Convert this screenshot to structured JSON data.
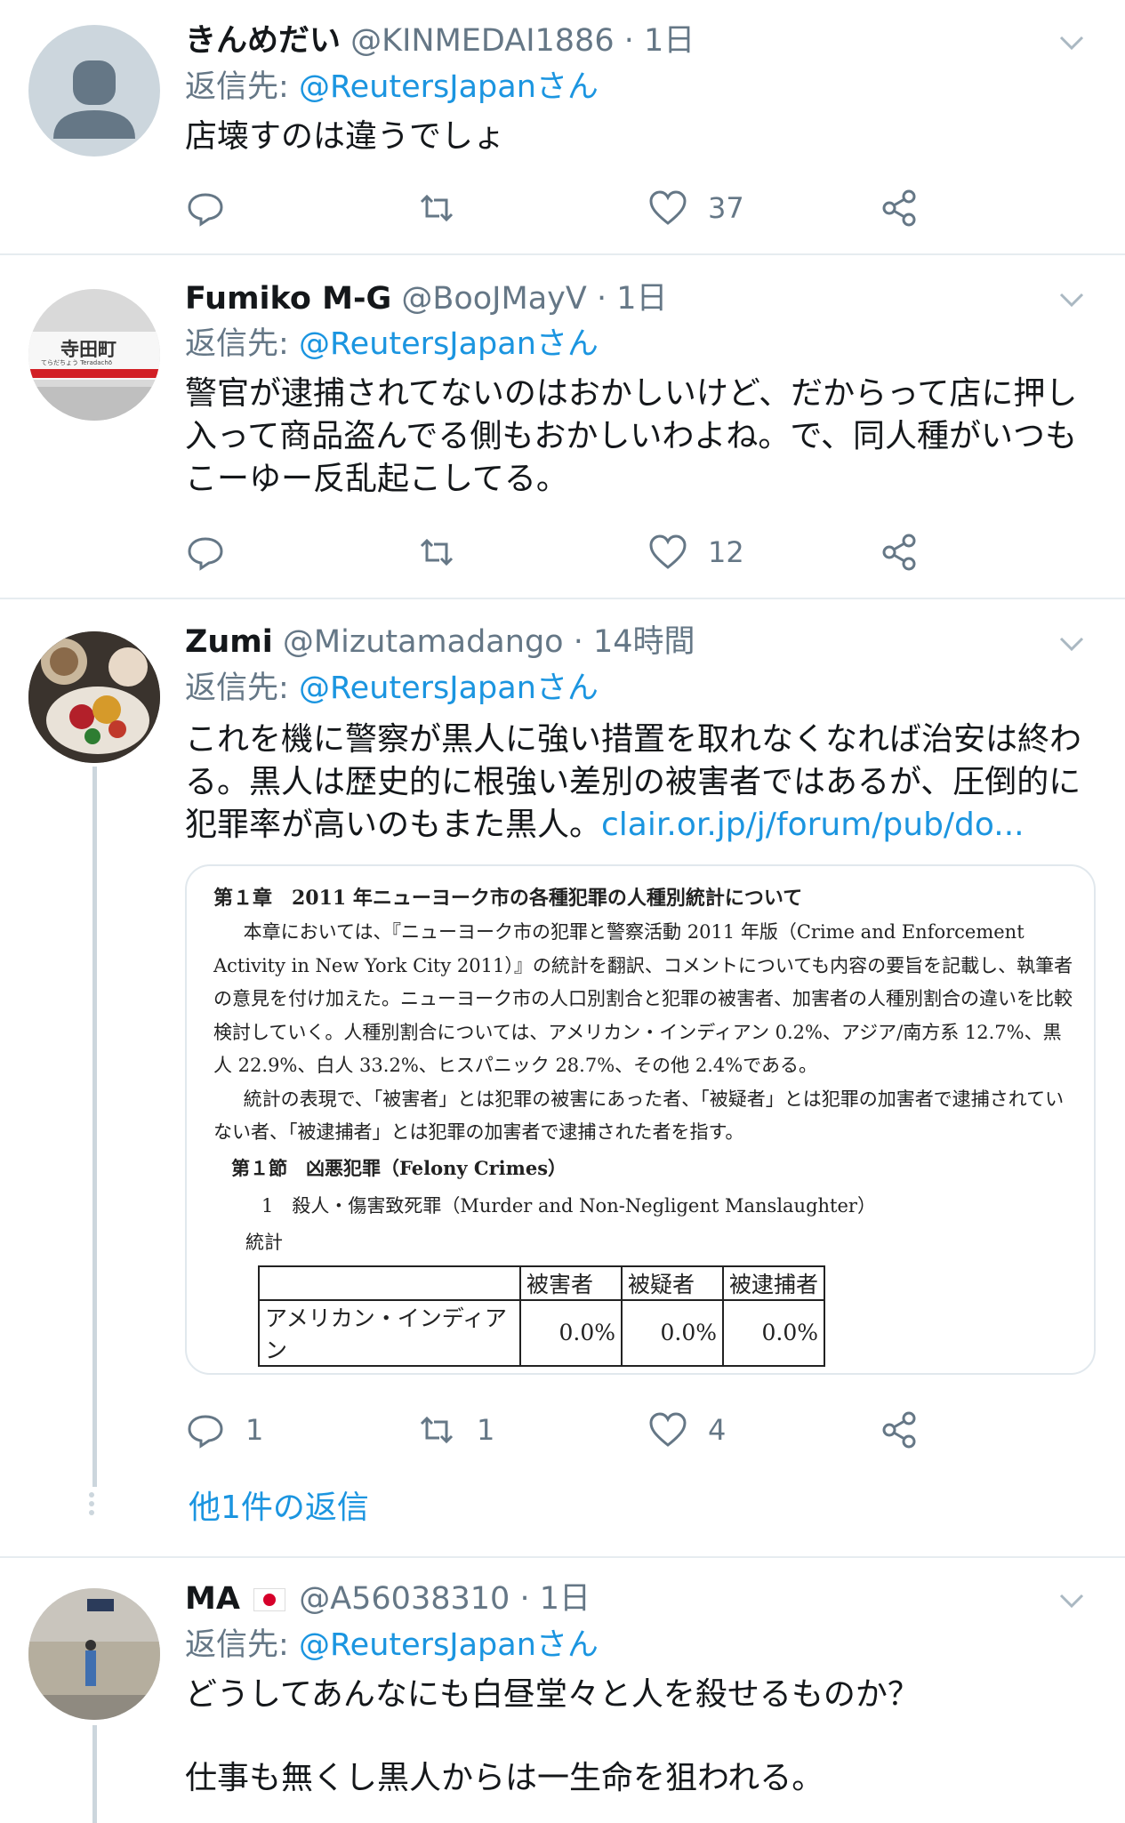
{
  "tweets": [
    {
      "name": "きんめだい",
      "handle": "@KINMEDAI1886",
      "time": "1日",
      "reply_prefix": "返信先:",
      "reply_mention": "@ReutersJapanさん",
      "text": "店壊すのは違うでしょ",
      "replies": "",
      "retweets": "",
      "likes": "37"
    },
    {
      "name": "Fumiko M-G",
      "handle": "@BooJMayV",
      "time": "1日",
      "reply_prefix": "返信先:",
      "reply_mention": "@ReutersJapanさん",
      "text": "警官が逮捕されてないのはおかしいけど、だからって店に押し入って商品盗んでる側もおかしいわよね。で、同人種がいつもこーゆー反乱起こしてる。",
      "replies": "",
      "retweets": "",
      "likes": "12",
      "avatar_sign": "寺田町",
      "avatar_sign_sub": "てらだちょう  Teradachō"
    },
    {
      "name": "Zumi",
      "handle": "@Mizutamadango",
      "time": "14時間",
      "reply_prefix": "返信先:",
      "reply_mention": "@ReutersJapanさん",
      "text": "これを機に警察が黒人に強い措置を取れなくなれば治安は終わる。黒人は歴史的に根強い差別の被害者ではあるが、圧倒的に犯罪率が高いのもまた黒人。",
      "link": "clair.or.jp/j/forum/pub/do...",
      "replies": "1",
      "retweets": "1",
      "likes": "4",
      "more_replies": "他1件の返信"
    },
    {
      "name": "MA",
      "handle": "@A56038310",
      "time": "1日",
      "reply_prefix": "返信先:",
      "reply_mention": "@ReutersJapanさん",
      "text": "どうしてあんなにも白昼堂々と人を殺せるものか？",
      "text2": "仕事も無くし黒人からは一生命を狙われる。"
    }
  ],
  "separator_dot": "·",
  "document": {
    "heading": "第１章　2011 年ニューヨーク市の各種犯罪の人種別統計について",
    "para1": "本章においては、『ニューヨーク市の犯罪と警察活動 2011 年版（Crime and Enforcement Activity in New York City 2011）』の統計を翻訳、コメントについても内容の要旨を記載し、執筆者の意見を付け加えた。ニューヨーク市の人口別割合と犯罪の被害者、加害者の人種別割合の違いを比較検討していく。人種別割合については、アメリカン・インディアン 0.2%、アジア/南方系 12.7%、黒人 22.9%、白人 33.2%、ヒスパニック 28.7%、その他 2.4%である。",
    "para2": "統計の表現で、「被害者」とは犯罪の被害にあった者、「被疑者」とは犯罪の加害者で逮捕されていない者、「被逮捕者」とは犯罪の加害者で逮捕された者を指す。",
    "section": "第１節　凶悪犯罪（Felony Crimes）",
    "subsection": "1　殺人・傷害致死罪（Murder and Non-Negligent Manslaughter）",
    "label": "統計",
    "table_headers": [
      "",
      "被害者",
      "被疑者",
      "被逮捕者"
    ],
    "table_row": [
      "アメリカン・インディアン",
      "0.0%",
      "0.0%",
      "0.0%"
    ]
  }
}
